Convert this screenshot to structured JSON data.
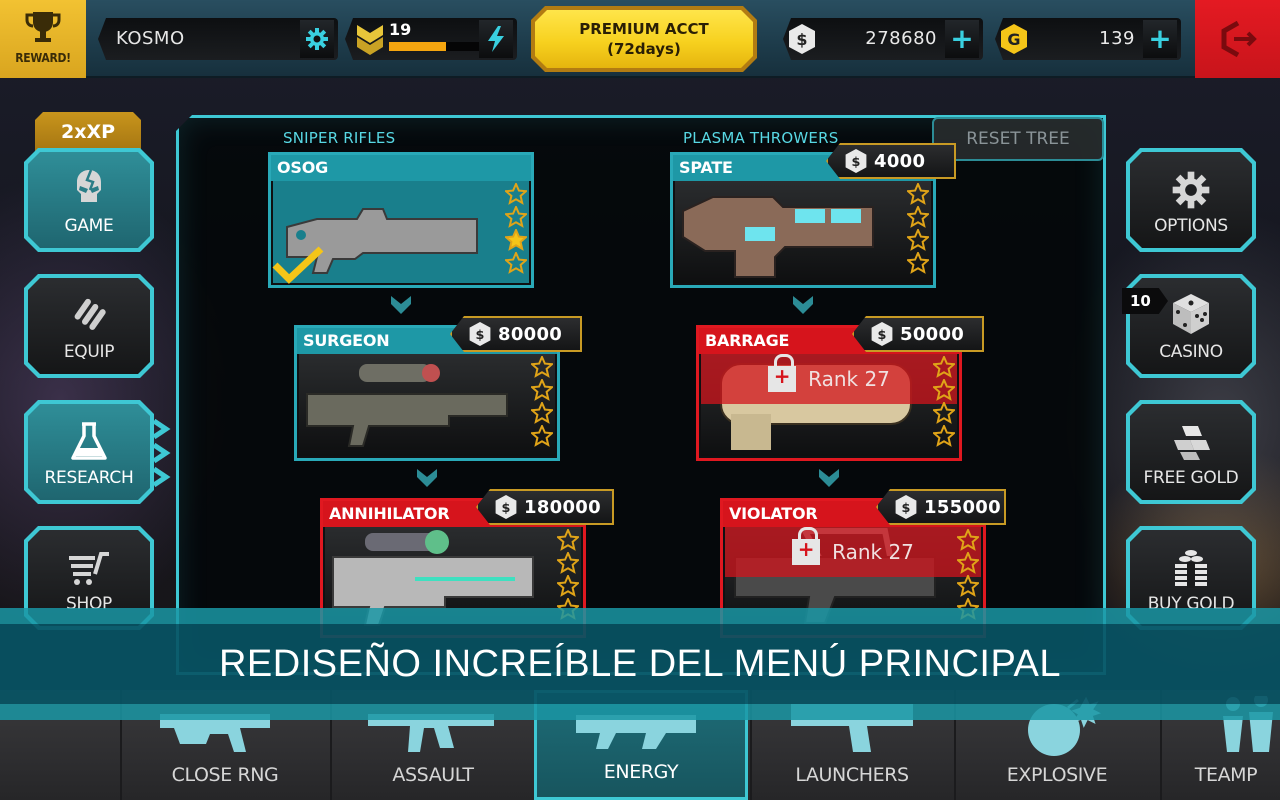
{
  "topbar": {
    "reward_label": "REWARD!",
    "player_name": "KOSMO",
    "level": "19",
    "xp_progress": 0.62,
    "premium_line1": "PREMIUM ACCT",
    "premium_line2": "(72days)",
    "cash_amount": "278680",
    "gold_amount": "139",
    "cash_symbol": "$",
    "gold_symbol": "G"
  },
  "left_nav": {
    "xp_badge": "2xXP",
    "items": [
      {
        "label": "GAME",
        "icon": "skull-icon"
      },
      {
        "label": "EQUIP",
        "icon": "bullets-icon"
      },
      {
        "label": "RESEARCH",
        "icon": "flask-icon"
      },
      {
        "label": "SHOP",
        "icon": "cart-icon"
      }
    ]
  },
  "right_nav": {
    "items": [
      {
        "label": "OPTIONS",
        "icon": "gear-icon"
      },
      {
        "label": "CASINO",
        "icon": "dice-icon",
        "badge": "10"
      },
      {
        "label": "FREE GOLD",
        "icon": "gold-bars-icon"
      },
      {
        "label": "BUY GOLD",
        "icon": "gold-coins-icon"
      }
    ]
  },
  "research": {
    "reset_label": "RESET TREE",
    "columns": [
      {
        "category": "SNIPER RIFLES",
        "weapons": [
          {
            "name": "OSOG",
            "status": "owned",
            "stars_filled": 1,
            "stars_total": 4,
            "filled_index": 2
          },
          {
            "name": "SURGEON",
            "status": "available",
            "price": "80000",
            "stars_filled": 0,
            "stars_total": 4
          },
          {
            "name": "ANNIHILATOR",
            "status": "locked-price",
            "price": "180000",
            "stars_filled": 0,
            "stars_total": 4
          }
        ]
      },
      {
        "category": "PLASMA THROWERS",
        "weapons": [
          {
            "name": "SPATE",
            "status": "available",
            "price": "4000",
            "stars_filled": 0,
            "stars_total": 4
          },
          {
            "name": "BARRAGE",
            "status": "locked",
            "price": "50000",
            "lock_text": "Rank 27",
            "stars_filled": 0,
            "stars_total": 4
          },
          {
            "name": "VIOLATOR",
            "status": "locked",
            "price": "155000",
            "lock_text": "Rank 27",
            "stars_filled": 0,
            "stars_total": 4
          }
        ]
      }
    ]
  },
  "caption": "REDISEÑO INCREÍBLE DEL MENÚ PRINCIPAL",
  "tabs": [
    {
      "label": "CLOSE RNG",
      "active": false
    },
    {
      "label": "ASSAULT",
      "active": false
    },
    {
      "label": "ENERGY",
      "active": true
    },
    {
      "label": "LAUNCHERS",
      "active": false
    },
    {
      "label": "EXPLOSIVE",
      "active": false
    },
    {
      "label": "TEAMP",
      "active": false
    }
  ],
  "colors": {
    "accent_cyan": "#3ec8d4",
    "gold": "#f5a50f",
    "locked_red": "#d6141c",
    "logout_red": "#e41a22"
  }
}
